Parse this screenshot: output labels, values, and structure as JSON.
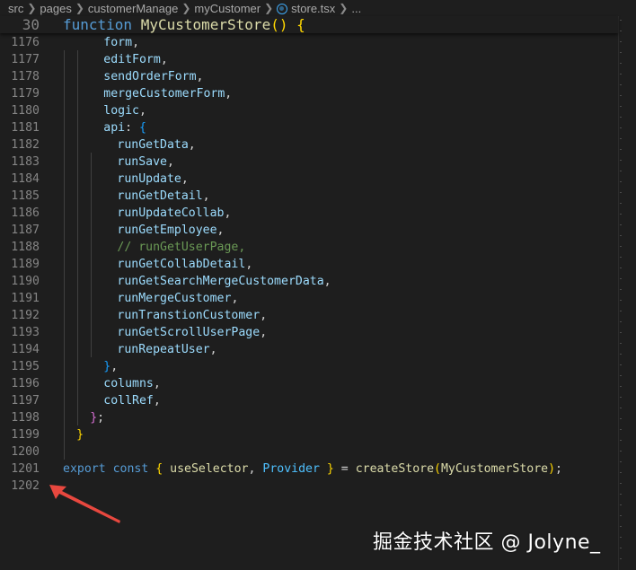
{
  "breadcrumb": {
    "items": [
      "src",
      "pages",
      "customerManage",
      "myCustomer"
    ],
    "file": "store.tsx",
    "ellipsis": "..."
  },
  "sticky_line": {
    "number": "30",
    "text": "function MyCustomerStore() {"
  },
  "code_lines": [
    {
      "number": "1176",
      "text": "form,"
    },
    {
      "number": "1177",
      "text": "editForm,"
    },
    {
      "number": "1178",
      "text": "sendOrderForm,"
    },
    {
      "number": "1179",
      "text": "mergeCustomerForm,"
    },
    {
      "number": "1180",
      "text": "logic,"
    },
    {
      "number": "1181",
      "text": "api: {"
    },
    {
      "number": "1182",
      "text": "runGetData,"
    },
    {
      "number": "1183",
      "text": "runSave,"
    },
    {
      "number": "1184",
      "text": "runUpdate,"
    },
    {
      "number": "1185",
      "text": "runGetDetail,"
    },
    {
      "number": "1186",
      "text": "runUpdateCollab,"
    },
    {
      "number": "1187",
      "text": "runGetEmployee,"
    },
    {
      "number": "1188",
      "text": "// runGetUserPage,"
    },
    {
      "number": "1189",
      "text": "runGetCollabDetail,"
    },
    {
      "number": "1190",
      "text": "runGetSearchMergeCustomerData,"
    },
    {
      "number": "1191",
      "text": "runMergeCustomer,"
    },
    {
      "number": "1192",
      "text": "runTranstionCustomer,"
    },
    {
      "number": "1193",
      "text": "runGetScrollUserPage,"
    },
    {
      "number": "1194",
      "text": "runRepeatUser,"
    },
    {
      "number": "1195",
      "text": "},"
    },
    {
      "number": "1196",
      "text": "columns,"
    },
    {
      "number": "1197",
      "text": "collRef,"
    },
    {
      "number": "1198",
      "text": "};"
    },
    {
      "number": "1199",
      "text": "}"
    },
    {
      "number": "1200",
      "text": ""
    },
    {
      "number": "1201",
      "text": "export const { useSelector, Provider } = createStore(MyCustomerStore);"
    },
    {
      "number": "1202",
      "text": ""
    }
  ],
  "watermark": "掘金技术社区 @ Jolyne_",
  "annotation_arrow_color": "#e8483f"
}
